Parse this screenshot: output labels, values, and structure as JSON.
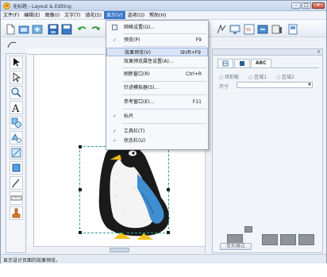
{
  "window": {
    "title": "无标题 - Layout & Editing",
    "buttons": {
      "minimize": "–",
      "maximize": "□",
      "close": "✕"
    }
  },
  "menubar": {
    "items": [
      "文件(F)",
      "编辑(E)",
      "图像(I)",
      "文字(T)",
      "填花(S)",
      "显示(V)",
      "选项(O)",
      "帮助(H)"
    ],
    "active_index": 5
  },
  "view_menu": {
    "items": [
      {
        "label": "网格设置(G)...",
        "shortcut": "",
        "checked": false,
        "icon": "grid-icon"
      },
      {
        "label": "预览(P)",
        "shortcut": "F9",
        "checked": true,
        "icon": ""
      },
      {
        "label": "效果预览(V)",
        "shortcut": "Shift+F9",
        "checked": false,
        "icon": "",
        "highlighted": true
      },
      {
        "label": "效果预览属性设置(A)...",
        "shortcut": "",
        "checked": false,
        "icon": ""
      },
      {
        "label": "刷新窗口(R)",
        "shortcut": "Ctrl+R",
        "checked": false,
        "icon": ""
      },
      {
        "label": "针迹模拟器(S)...",
        "shortcut": "",
        "checked": false,
        "icon": ""
      },
      {
        "label": "参考窗口(E)...",
        "shortcut": "F11",
        "checked": false,
        "icon": ""
      },
      {
        "label": "标尺",
        "shortcut": "",
        "checked": true,
        "icon": ""
      },
      {
        "label": "工具栏(T)",
        "shortcut": "",
        "checked": true,
        "icon": ""
      },
      {
        "label": "状态栏(U)",
        "shortcut": "",
        "checked": true,
        "icon": ""
      }
    ]
  },
  "right_panel": {
    "tabs": [
      "ABC"
    ],
    "radio_labels": [
      "矩形板",
      "区域1",
      "区域2"
    ],
    "size_label": "尺寸",
    "size_value": "",
    "action_button": "变形模式"
  },
  "canvas": {
    "hscroll_label": "",
    "accent_selection": "#2aa58f"
  },
  "status": {
    "text": "显示设计页面的效果预览。"
  },
  "colors": {
    "accent": "#3a78c9",
    "penguin_blue": "#3f8ed0",
    "penguin_black": "#1a1a1a"
  }
}
